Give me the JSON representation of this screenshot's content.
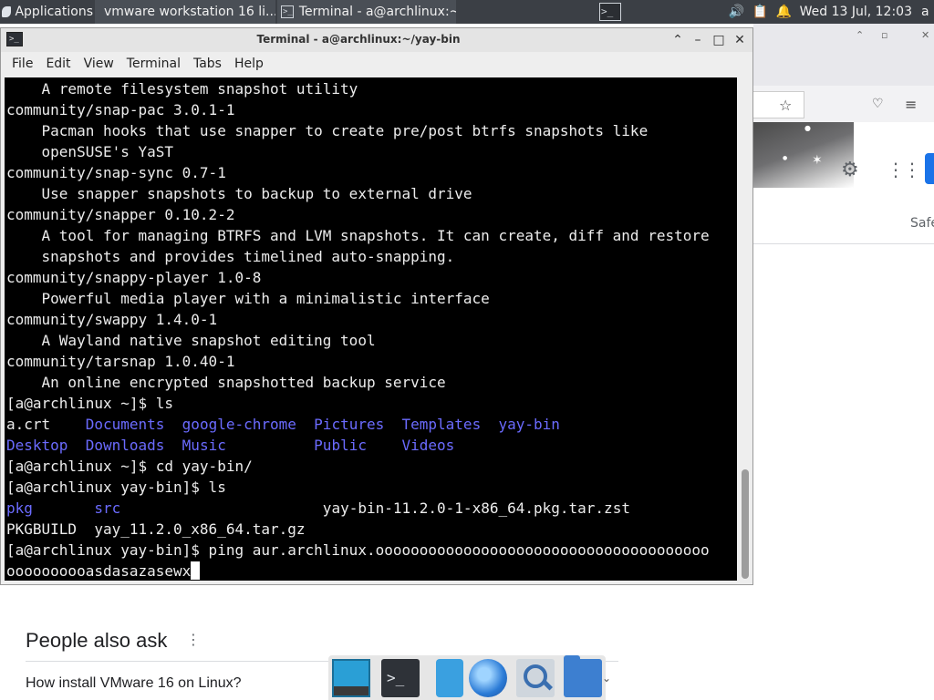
{
  "panel": {
    "applications_label": "Applications",
    "firefox_task": "vmware workstation 16 li...",
    "terminal_task": "Terminal - a@archlinux:~/...",
    "clock": "Wed 13 Jul, 12:03",
    "user_initial": "a"
  },
  "browser": {
    "safe_label": "Safe",
    "people_also_ask": "People also ask",
    "question_1": "How install VMware 16 on Linux?",
    "colors": {
      "signin_button": "#1a73e8"
    }
  },
  "terminal": {
    "title": "Terminal - a@archlinux:~/yay-bin",
    "menu": [
      "File",
      "Edit",
      "View",
      "Terminal",
      "Tabs",
      "Help"
    ],
    "lines": [
      [
        {
          "t": "    A remote filesystem snapshot utility"
        }
      ],
      [
        {
          "t": "community/snap-pac 3.0.1-1"
        }
      ],
      [
        {
          "t": "    Pacman hooks that use snapper to create pre/post btrfs snapshots like"
        }
      ],
      [
        {
          "t": "    openSUSE's YaST"
        }
      ],
      [
        {
          "t": "community/snap-sync 0.7-1"
        }
      ],
      [
        {
          "t": "    Use snapper snapshots to backup to external drive"
        }
      ],
      [
        {
          "t": "community/snapper 0.10.2-2"
        }
      ],
      [
        {
          "t": "    A tool for managing BTRFS and LVM snapshots. It can create, diff and restore"
        }
      ],
      [
        {
          "t": "    snapshots and provides timelined auto-snapping."
        }
      ],
      [
        {
          "t": "community/snappy-player 1.0-8"
        }
      ],
      [
        {
          "t": "    Powerful media player with a minimalistic interface"
        }
      ],
      [
        {
          "t": "community/swappy 1.4.0-1"
        }
      ],
      [
        {
          "t": "    A Wayland native snapshot editing tool"
        }
      ],
      [
        {
          "t": "community/tarsnap 1.0.40-1"
        }
      ],
      [
        {
          "t": "    An online encrypted snapshotted backup service"
        }
      ],
      [
        {
          "t": "[a@archlinux ~]$ ls"
        }
      ],
      [
        {
          "t": "a.crt    "
        },
        {
          "t": "Documents",
          "dir": true
        },
        {
          "t": "  "
        },
        {
          "t": "google-chrome",
          "dir": true
        },
        {
          "t": "  "
        },
        {
          "t": "Pictures",
          "dir": true
        },
        {
          "t": "  "
        },
        {
          "t": "Templates",
          "dir": true
        },
        {
          "t": "  "
        },
        {
          "t": "yay-bin",
          "dir": true
        }
      ],
      [
        {
          "t": "Desktop",
          "dir": true
        },
        {
          "t": "  "
        },
        {
          "t": "Downloads",
          "dir": true
        },
        {
          "t": "  "
        },
        {
          "t": "Music",
          "dir": true
        },
        {
          "t": "          "
        },
        {
          "t": "Public",
          "dir": true
        },
        {
          "t": "    "
        },
        {
          "t": "Videos",
          "dir": true
        }
      ],
      [
        {
          "t": "[a@archlinux ~]$ cd yay-bin/"
        }
      ],
      [
        {
          "t": "[a@archlinux yay-bin]$ ls"
        }
      ],
      [
        {
          "t": "pkg",
          "dir": true
        },
        {
          "t": "       "
        },
        {
          "t": "src",
          "dir": true
        },
        {
          "t": "                       yay-bin-11.2.0-1-x86_64.pkg.tar.zst"
        }
      ],
      [
        {
          "t": "PKGBUILD  yay_11.2.0_x86_64.tar.gz"
        }
      ],
      [
        {
          "t": "[a@archlinux yay-bin]$ ping aur.archlinux.oooooooooooooooooooooooooooooooooooooo"
        }
      ],
      [
        {
          "t": "oooooooooasdasazasewx"
        },
        {
          "cursor": true
        }
      ]
    ],
    "colors": {
      "background": "#000000",
      "text": "#ececec",
      "directory": "#6b6bff"
    }
  }
}
